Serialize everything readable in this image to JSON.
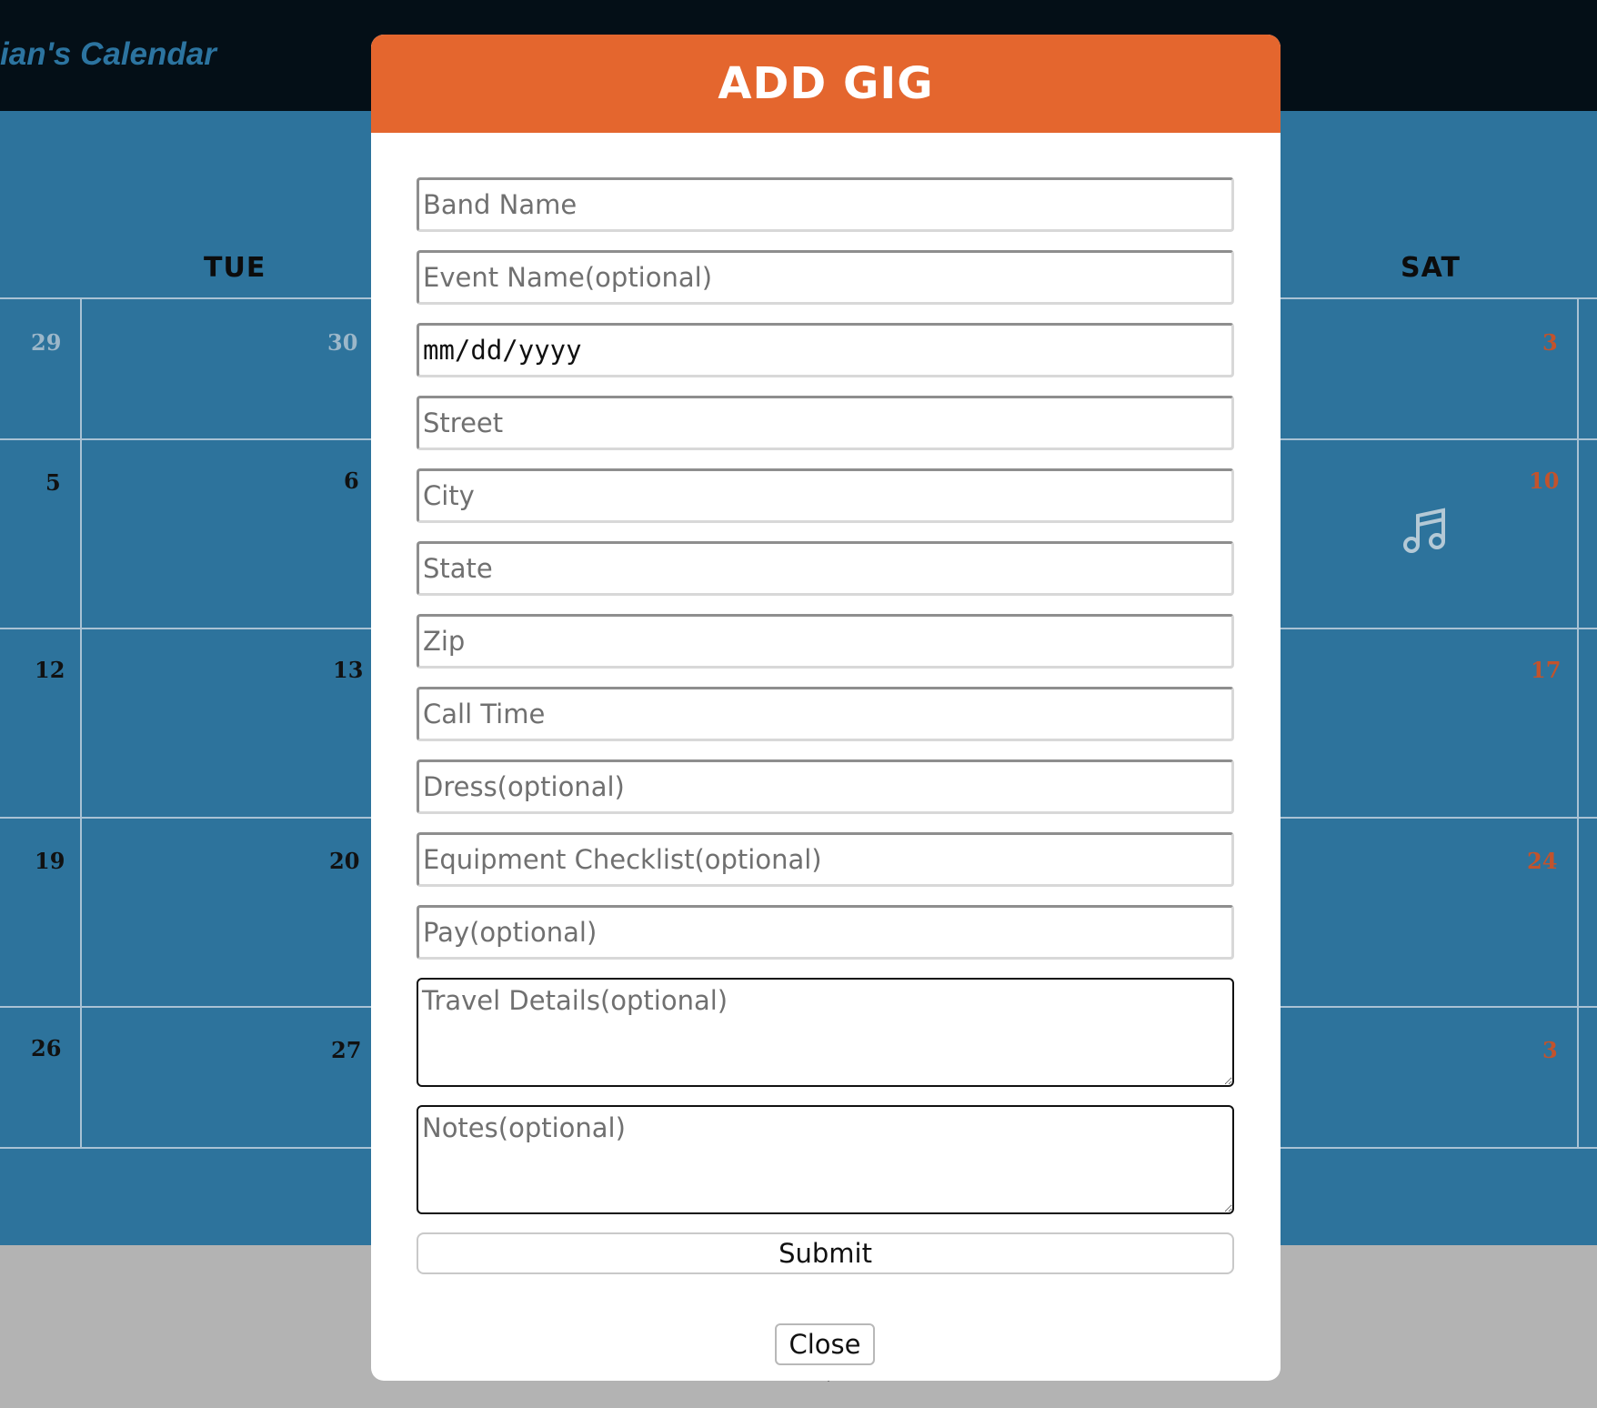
{
  "app": {
    "title": "ian's Calendar"
  },
  "calendar": {
    "weekdays": {
      "tue": "TUE",
      "sat": "SAT"
    },
    "days": {
      "r1": [
        "29",
        "30",
        "3"
      ],
      "r2": [
        "5",
        "6",
        "10"
      ],
      "r3": [
        "12",
        "13",
        "17"
      ],
      "r4": [
        "19",
        "20",
        "24"
      ],
      "r5": [
        "26",
        "27",
        "3"
      ]
    },
    "icons": {
      "event": "music-note-icon"
    }
  },
  "modal": {
    "title": "ADD GIG",
    "fields": {
      "band_name": "Band Name",
      "event_name": "Event Name(optional)",
      "date": "mm/dd/yyyy",
      "street": "Street",
      "city": "City",
      "state": "State",
      "zip": "Zip",
      "call_time": "Call Time",
      "dress": "Dress(optional)",
      "equipment": "Equipment Checklist(optional)",
      "pay": "Pay(optional)",
      "travel": "Travel Details(optional)",
      "notes": "Notes(optional)"
    },
    "submit_label": "Submit",
    "close_label": "Close"
  },
  "colors": {
    "header_bg": "#040f17",
    "calendar_bg": "#2d739c",
    "modal_header": "#e4662e",
    "saturday": "#c2532c"
  }
}
